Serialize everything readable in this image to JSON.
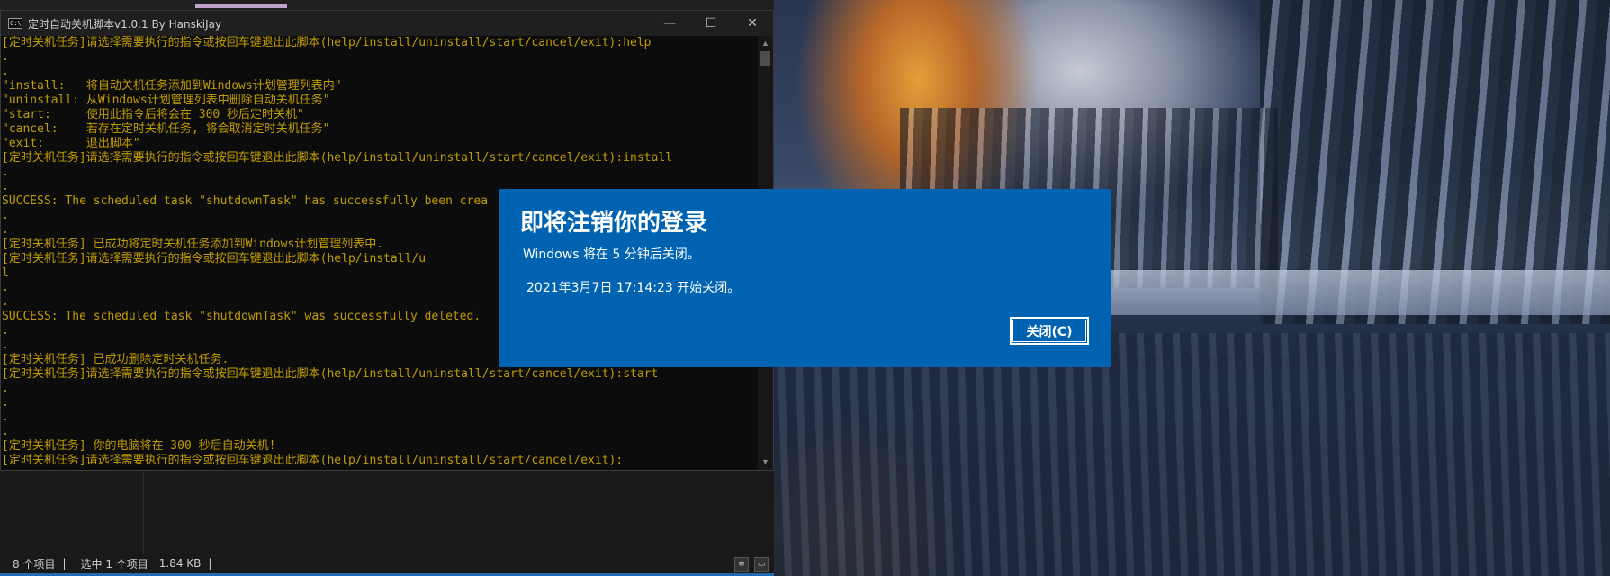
{
  "console": {
    "title": "定时自动关机脚本v1.0.1 By HanskiJay",
    "icon": "cmd-icon",
    "icon_text": "C:\\",
    "controls": {
      "minimize": "—",
      "maximize": "☐",
      "close": "✕"
    },
    "lines": [
      "[定时关机任务]请选择需要执行的指令或按回车键退出此脚本(help/install/uninstall/start/cancel/exit):help",
      ".",
      ".",
      "\"install:   将自动关机任务添加到Windows计划管理列表内\"",
      "\"uninstall: 从Windows计划管理列表中删除自动关机任务\"",
      "\"start:     使用此指令后将会在 300 秒后定时关机\"",
      "\"cancel:    若存在定时关机任务, 将会取消定时关机任务\"",
      "\"exit:      退出脚本\"",
      "[定时关机任务]请选择需要执行的指令或按回车键退出此脚本(help/install/uninstall/start/cancel/exit):install",
      ".",
      ".",
      "SUCCESS: The scheduled task \"shutdownTask\" has successfully been crea",
      ".",
      ".",
      "[定时关机任务] 已成功将定时关机任务添加到Windows计划管理列表中.",
      "[定时关机任务]请选择需要执行的指令或按回车键退出此脚本(help/install/u",
      "l",
      ".",
      ".",
      "SUCCESS: The scheduled task \"shutdownTask\" was successfully deleted.",
      ".",
      ".",
      "[定时关机任务] 已成功删除定时关机任务.",
      "[定时关机任务]请选择需要执行的指令或按回车键退出此脚本(help/install/uninstall/start/cancel/exit):start",
      ".",
      ".",
      ".",
      ".",
      "[定时关机任务] 你的电脑将在 300 秒后自动关机!",
      "[定时关机任务]请选择需要执行的指令或按回车键退出此脚本(help/install/uninstall/start/cancel/exit):"
    ]
  },
  "explorer_status": {
    "item_count": "8 个项目",
    "selected": "选中 1 个项目",
    "size": "1.84 KB",
    "separator": "|"
  },
  "dialog": {
    "title": "即将注销你的登录",
    "message": "Windows 将在 5 分钟后关闭。",
    "time": "2021年3月7日 17:14:23 开始关闭。",
    "close_button": "关闭(C)"
  },
  "colors": {
    "console_text": "#c19c00",
    "dialog_bg": "#0063b1"
  }
}
